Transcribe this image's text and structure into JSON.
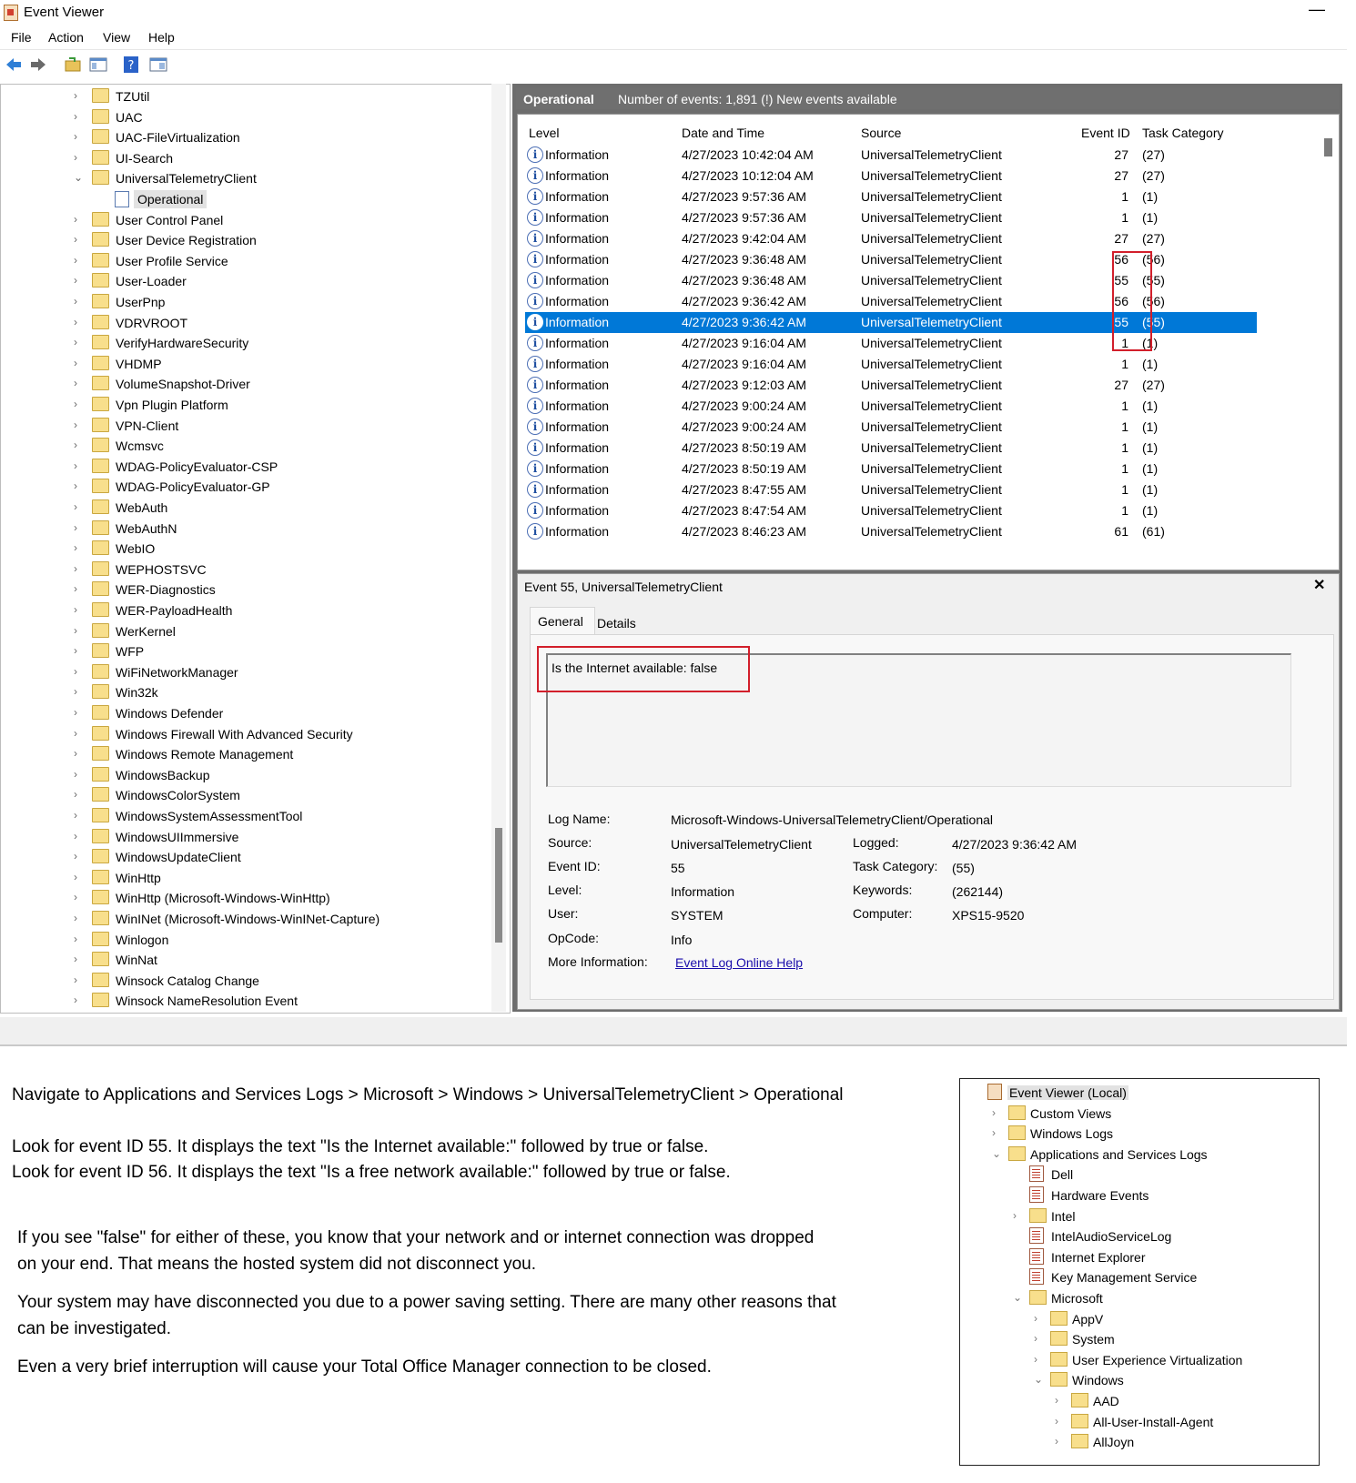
{
  "window": {
    "title": "Event Viewer",
    "minimize": "—"
  },
  "menu": [
    "File",
    "Action",
    "View",
    "Help"
  ],
  "tree": {
    "items": [
      {
        "label": "TZUtil",
        "chevron": "›"
      },
      {
        "label": "UAC",
        "chevron": "›"
      },
      {
        "label": "UAC-FileVirtualization",
        "chevron": "›"
      },
      {
        "label": "UI-Search",
        "chevron": "›"
      },
      {
        "label": "UniversalTelemetryClient",
        "chevron": "⌄"
      },
      {
        "label": "Operational",
        "chevron": ""
      },
      {
        "label": "User Control Panel",
        "chevron": "›"
      },
      {
        "label": "User Device Registration",
        "chevron": "›"
      },
      {
        "label": "User Profile Service",
        "chevron": "›"
      },
      {
        "label": "User-Loader",
        "chevron": "›"
      },
      {
        "label": "UserPnp",
        "chevron": "›"
      },
      {
        "label": "VDRVROOT",
        "chevron": "›"
      },
      {
        "label": "VerifyHardwareSecurity",
        "chevron": "›"
      },
      {
        "label": "VHDMP",
        "chevron": "›"
      },
      {
        "label": "VolumeSnapshot-Driver",
        "chevron": "›"
      },
      {
        "label": "Vpn Plugin Platform",
        "chevron": "›"
      },
      {
        "label": "VPN-Client",
        "chevron": "›"
      },
      {
        "label": "Wcmsvc",
        "chevron": "›"
      },
      {
        "label": "WDAG-PolicyEvaluator-CSP",
        "chevron": "›"
      },
      {
        "label": "WDAG-PolicyEvaluator-GP",
        "chevron": "›"
      },
      {
        "label": "WebAuth",
        "chevron": "›"
      },
      {
        "label": "WebAuthN",
        "chevron": "›"
      },
      {
        "label": "WebIO",
        "chevron": "›"
      },
      {
        "label": "WEPHOSTSVC",
        "chevron": "›"
      },
      {
        "label": "WER-Diagnostics",
        "chevron": "›"
      },
      {
        "label": "WER-PayloadHealth",
        "chevron": "›"
      },
      {
        "label": "WerKernel",
        "chevron": "›"
      },
      {
        "label": "WFP",
        "chevron": "›"
      },
      {
        "label": "WiFiNetworkManager",
        "chevron": "›"
      },
      {
        "label": "Win32k",
        "chevron": "›"
      },
      {
        "label": "Windows Defender",
        "chevron": "›"
      },
      {
        "label": "Windows Firewall With Advanced Security",
        "chevron": "›"
      },
      {
        "label": "Windows Remote Management",
        "chevron": "›"
      },
      {
        "label": "WindowsBackup",
        "chevron": "›"
      },
      {
        "label": "WindowsColorSystem",
        "chevron": "›"
      },
      {
        "label": "WindowsSystemAssessmentTool",
        "chevron": "›"
      },
      {
        "label": "WindowsUIImmersive",
        "chevron": "›"
      },
      {
        "label": "WindowsUpdateClient",
        "chevron": "›"
      },
      {
        "label": "WinHttp",
        "chevron": "›"
      },
      {
        "label": "WinHttp (Microsoft-Windows-WinHttp)",
        "chevron": "›"
      },
      {
        "label": "WinINet (Microsoft-Windows-WinINet-Capture)",
        "chevron": "›"
      },
      {
        "label": "Winlogon",
        "chevron": "›"
      },
      {
        "label": "WinNat",
        "chevron": "›"
      },
      {
        "label": "Winsock Catalog Change",
        "chevron": "›"
      },
      {
        "label": "Winsock NameResolution Event",
        "chevron": "›"
      }
    ]
  },
  "log": {
    "name": "Operational",
    "count": "Number of events: 1,891 (!) New events available"
  },
  "columns": {
    "level": "Level",
    "datetime": "Date and Time",
    "source": "Source",
    "event_id": "Event ID",
    "task": "Task Category"
  },
  "events": [
    {
      "level": "Information",
      "datetime": "4/27/2023 10:42:04 AM",
      "source": "UniversalTelemetryClient",
      "id": "27",
      "task": "(27)"
    },
    {
      "level": "Information",
      "datetime": "4/27/2023 10:12:04 AM",
      "source": "UniversalTelemetryClient",
      "id": "27",
      "task": "(27)"
    },
    {
      "level": "Information",
      "datetime": "4/27/2023 9:57:36 AM",
      "source": "UniversalTelemetryClient",
      "id": "1",
      "task": "(1)"
    },
    {
      "level": "Information",
      "datetime": "4/27/2023 9:57:36 AM",
      "source": "UniversalTelemetryClient",
      "id": "1",
      "task": "(1)"
    },
    {
      "level": "Information",
      "datetime": "4/27/2023 9:42:04 AM",
      "source": "UniversalTelemetryClient",
      "id": "27",
      "task": "(27)"
    },
    {
      "level": "Information",
      "datetime": "4/27/2023 9:36:48 AM",
      "source": "UniversalTelemetryClient",
      "id": "56",
      "task": "(56)"
    },
    {
      "level": "Information",
      "datetime": "4/27/2023 9:36:48 AM",
      "source": "UniversalTelemetryClient",
      "id": "55",
      "task": "(55)"
    },
    {
      "level": "Information",
      "datetime": "4/27/2023 9:36:42 AM",
      "source": "UniversalTelemetryClient",
      "id": "56",
      "task": "(56)"
    },
    {
      "level": "Information",
      "datetime": "4/27/2023 9:36:42 AM",
      "source": "UniversalTelemetryClient",
      "id": "55",
      "task": "(55)"
    },
    {
      "level": "Information",
      "datetime": "4/27/2023 9:16:04 AM",
      "source": "UniversalTelemetryClient",
      "id": "1",
      "task": "(1)"
    },
    {
      "level": "Information",
      "datetime": "4/27/2023 9:16:04 AM",
      "source": "UniversalTelemetryClient",
      "id": "1",
      "task": "(1)"
    },
    {
      "level": "Information",
      "datetime": "4/27/2023 9:12:03 AM",
      "source": "UniversalTelemetryClient",
      "id": "27",
      "task": "(27)"
    },
    {
      "level": "Information",
      "datetime": "4/27/2023 9:00:24 AM",
      "source": "UniversalTelemetryClient",
      "id": "1",
      "task": "(1)"
    },
    {
      "level": "Information",
      "datetime": "4/27/2023 9:00:24 AM",
      "source": "UniversalTelemetryClient",
      "id": "1",
      "task": "(1)"
    },
    {
      "level": "Information",
      "datetime": "4/27/2023 8:50:19 AM",
      "source": "UniversalTelemetryClient",
      "id": "1",
      "task": "(1)"
    },
    {
      "level": "Information",
      "datetime": "4/27/2023 8:50:19 AM",
      "source": "UniversalTelemetryClient",
      "id": "1",
      "task": "(1)"
    },
    {
      "level": "Information",
      "datetime": "4/27/2023 8:47:55 AM",
      "source": "UniversalTelemetryClient",
      "id": "1",
      "task": "(1)"
    },
    {
      "level": "Information",
      "datetime": "4/27/2023 8:47:54 AM",
      "source": "UniversalTelemetryClient",
      "id": "1",
      "task": "(1)"
    },
    {
      "level": "Information",
      "datetime": "4/27/2023 8:46:23 AM",
      "source": "UniversalTelemetryClient",
      "id": "61",
      "task": "(61)"
    }
  ],
  "detail": {
    "title": "Event 55, UniversalTelemetryClient",
    "close": "✕",
    "tabs": {
      "general": "General",
      "details": "Details"
    },
    "description": "Is the Internet available: false",
    "fields": {
      "log_name_k": "Log Name:",
      "log_name_v": "Microsoft-Windows-UniversalTelemetryClient/Operational",
      "source_k": "Source:",
      "source_v": "UniversalTelemetryClient",
      "logged_k": "Logged:",
      "logged_v": "4/27/2023 9:36:42 AM",
      "event_id_k": "Event ID:",
      "event_id_v": "55",
      "task_k": "Task Category:",
      "task_v": "(55)",
      "level_k": "Level:",
      "level_v": "Information",
      "keywords_k": "Keywords:",
      "keywords_v": "(262144)",
      "user_k": "User:",
      "user_v": "SYSTEM",
      "computer_k": "Computer:",
      "computer_v": "XPS15-9520",
      "opcode_k": "OpCode:",
      "opcode_v": "Info",
      "more_k": "More Information:",
      "more_v": "Event Log Online Help"
    }
  },
  "instructions": {
    "nav": "Navigate to Applications and Services Logs > Microsoft > Windows > UniversalTelemetryClient > Operational",
    "look55": "Look for event ID 55. It displays the text \"Is the Internet available:\" followed by true or false.",
    "look56": "Look for event ID 56. It displays the text \"Is a free network available:\" followed by true or false.",
    "false1": "If you see \"false\" for either of these, you know that your network and or internet connection was dropped",
    "false2": "on your end. That means the hosted system did not disconnect you.",
    "power1": "Your system may have disconnected you due to a power saving setting. There are many other reasons that",
    "power2": "can be investigated.",
    "brief": "Even a very brief interruption will cause your Total Office Manager connection to be closed."
  },
  "small_tree": [
    {
      "label": "Event Viewer (Local)",
      "icon": "root",
      "chevron": ""
    },
    {
      "label": "Custom Views",
      "icon": "folder",
      "chevron": "›"
    },
    {
      "label": "Windows Logs",
      "icon": "folder",
      "chevron": "›"
    },
    {
      "label": "Applications and Services Logs",
      "icon": "folder",
      "chevron": "⌄"
    },
    {
      "label": "Dell",
      "icon": "log",
      "chevron": ""
    },
    {
      "label": "Hardware Events",
      "icon": "log",
      "chevron": ""
    },
    {
      "label": "Intel",
      "icon": "folder",
      "chevron": "›"
    },
    {
      "label": "IntelAudioServiceLog",
      "icon": "log",
      "chevron": ""
    },
    {
      "label": "Internet Explorer",
      "icon": "log",
      "chevron": ""
    },
    {
      "label": "Key Management Service",
      "icon": "log",
      "chevron": ""
    },
    {
      "label": "Microsoft",
      "icon": "folder",
      "chevron": "⌄"
    },
    {
      "label": "AppV",
      "icon": "folder",
      "chevron": "›"
    },
    {
      "label": "System",
      "icon": "folder",
      "chevron": "›"
    },
    {
      "label": "User Experience Virtualization",
      "icon": "folder",
      "chevron": "›"
    },
    {
      "label": "Windows",
      "icon": "folder",
      "chevron": "⌄"
    },
    {
      "label": "AAD",
      "icon": "folder",
      "chevron": "›"
    },
    {
      "label": "All-User-Install-Agent",
      "icon": "folder",
      "chevron": "›"
    },
    {
      "label": "AllJoyn",
      "icon": "folder",
      "chevron": "›"
    }
  ]
}
